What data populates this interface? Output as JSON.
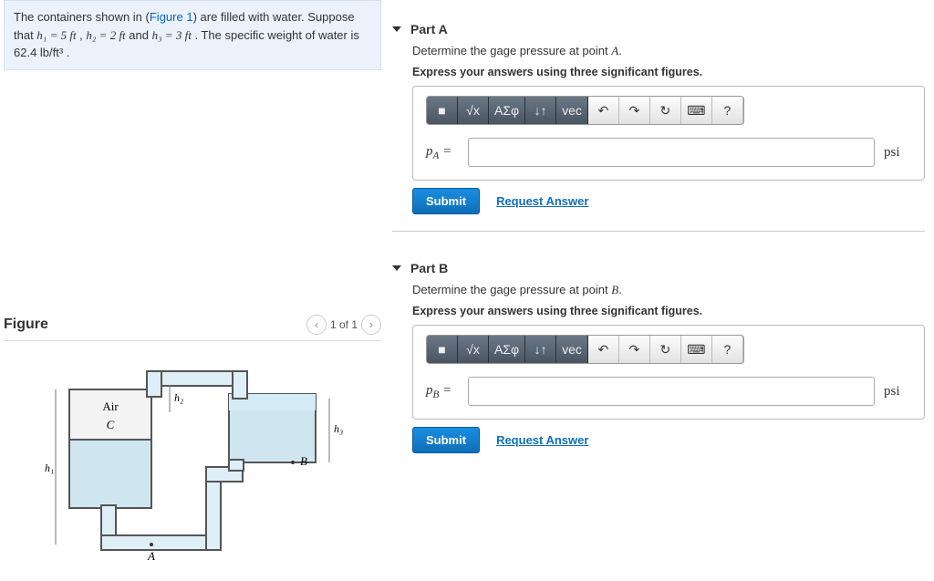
{
  "problem": {
    "prefix": "The containers shown in (",
    "figref": "Figure 1",
    "after_figref": ") are filled with water. Suppose that ",
    "h1": "h₁ = 5 ft",
    "sep1": " , ",
    "h2": "h₂ = 2 ft",
    "sep2": " and ",
    "h3": "h₃ = 3 ft",
    "tail": " . The specific weight of water is 62.4 lb/ft³ ."
  },
  "figure": {
    "title": "Figure",
    "nav": "1 of 1",
    "labels": {
      "air": "Air",
      "A": "A",
      "B": "B",
      "C": "C",
      "h1": "h₁",
      "h2": "h₂",
      "h3": "h₃"
    }
  },
  "parts": [
    {
      "id": "A",
      "title": "Part A",
      "prompt_pre": "Determine the gage pressure at point ",
      "prompt_pt": "A",
      "prompt_post": ".",
      "instruct": "Express your answers using three significant figures.",
      "var_label": "p_A =",
      "unit": "psi",
      "submit": "Submit",
      "request": "Request Answer",
      "toolbar": {
        "t1": "■",
        "t2": "√x",
        "t3": "ΑΣφ",
        "t4": "↓↑",
        "t5": "vec",
        "t6": "↶",
        "t7": "↷",
        "t8": "↻",
        "t9": "⌨",
        "t10": "?"
      }
    },
    {
      "id": "B",
      "title": "Part B",
      "prompt_pre": "Determine the gage pressure at point ",
      "prompt_pt": "B",
      "prompt_post": ".",
      "instruct": "Express your answers using three significant figures.",
      "var_label": "p_B =",
      "unit": "psi",
      "submit": "Submit",
      "request": "Request Answer",
      "toolbar": {
        "t1": "■",
        "t2": "√x",
        "t3": "ΑΣφ",
        "t4": "↓↑",
        "t5": "vec",
        "t6": "↶",
        "t7": "↷",
        "t8": "↻",
        "t9": "⌨",
        "t10": "?"
      }
    }
  ]
}
